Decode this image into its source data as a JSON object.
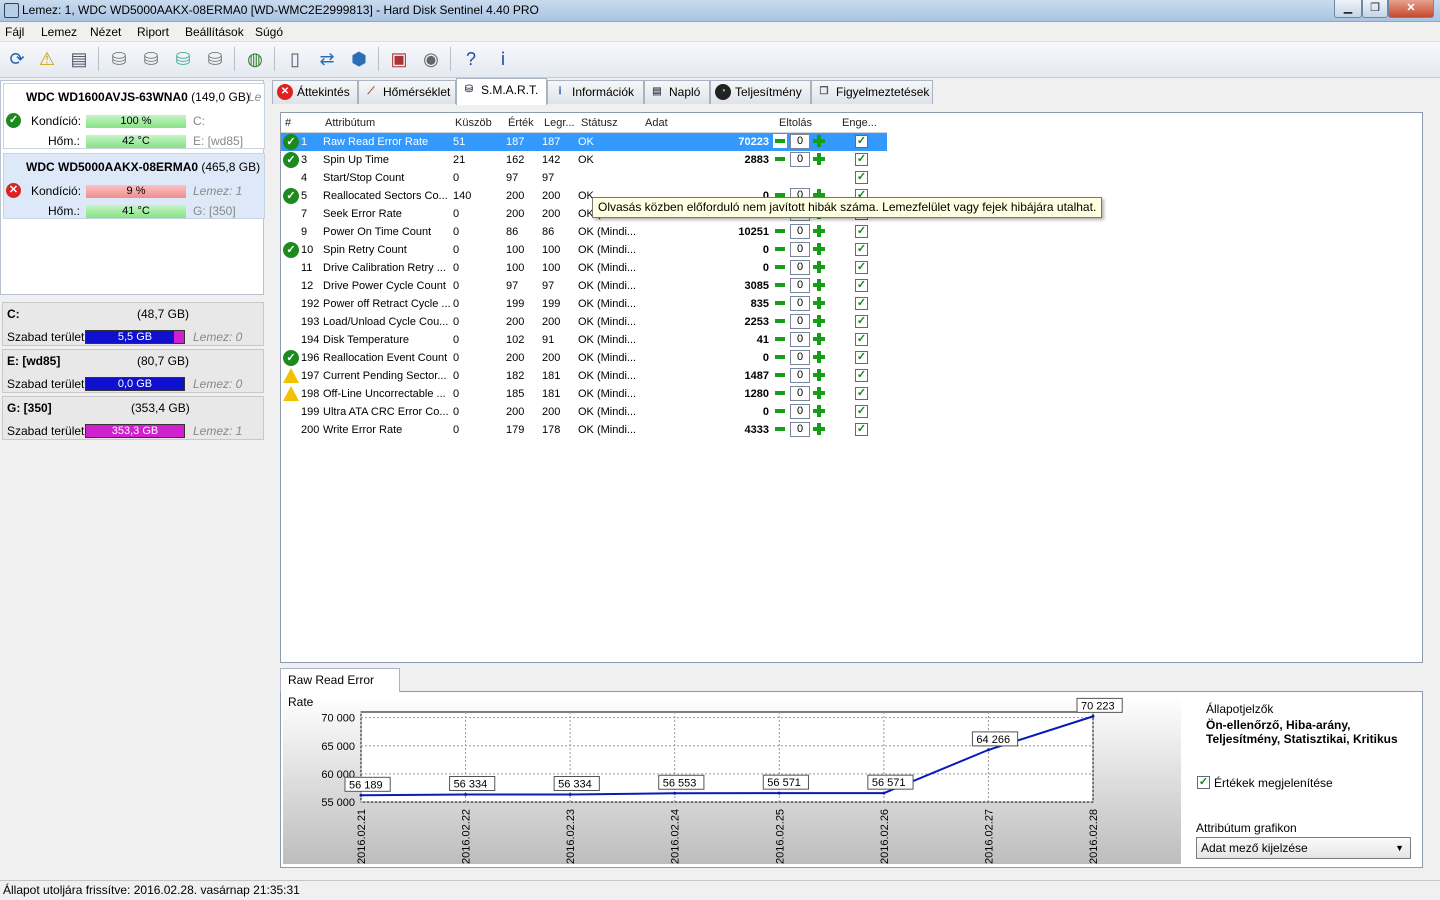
{
  "window": {
    "title": "Lemez: 1, WDC WD5000AAKX-08ERMA0 [WD-WMC2E2999813]  -  Hard Disk Sentinel 4.40 PRO"
  },
  "menu": [
    "Fájl",
    "Lemez",
    "Nézet",
    "Riport",
    "Beállítások",
    "Súgó"
  ],
  "disks": [
    {
      "name": "WDC WD1600AVJS-63WNA0",
      "size": "(149,0 GB)",
      "side_label": "Le",
      "condition_label": "Kondíció:",
      "condition": "100 %",
      "condition_fraction": 1.0,
      "temp_label": "Hőm.:",
      "temp": "42 °C",
      "drive1": "C:",
      "drive2": "E: [wd85]"
    },
    {
      "name": "WDC WD5000AAKX-08ERMA0",
      "size": "(465,8 GB)",
      "condition_label": "Kondíció:",
      "condition": "9 %",
      "condition_fraction": 0.09,
      "temp_label": "Hőm.:",
      "temp": "41 °C",
      "drive1": "Lemez: 1",
      "drive2": "G: [350]"
    }
  ],
  "volumes": [
    {
      "name": "C:",
      "size": "(48,7 GB)",
      "free_label": "Szabad terület",
      "free": "5,5 GB",
      "disk": "Lemez: 0"
    },
    {
      "name": "E: [wd85]",
      "size": "(80,7 GB)",
      "free_label": "Szabad terület",
      "free": "0,0 GB",
      "disk": "Lemez: 0"
    },
    {
      "name": "G: [350]",
      "size": "(353,4 GB)",
      "free_label": "Szabad terület",
      "free": "353,3 GB",
      "disk": "Lemez: 1"
    }
  ],
  "tabs": [
    "Áttekintés",
    "Hőmérséklet",
    "S.M.A.R.T.",
    "Információk",
    "Napló",
    "Teljesítmény",
    "Figyelmeztetések"
  ],
  "smart": {
    "headers": {
      "num": "#",
      "attr": "Attribútum",
      "threshold": "Küszöb",
      "value": "Érték",
      "worst": "Legr...",
      "status": "Státusz",
      "data": "Adat",
      "offset": "Eltolás",
      "enable": "Enge..."
    },
    "rows": [
      {
        "icon": "ok",
        "num": "1",
        "attr": "Raw Read Error Rate",
        "threshold": "51",
        "value": "187",
        "worst": "187",
        "status": "OK",
        "data": "70223",
        "offset": "0"
      },
      {
        "icon": "ok",
        "num": "3",
        "attr": "Spin Up Time",
        "threshold": "21",
        "value": "162",
        "worst": "142",
        "status": "OK",
        "data": "2883",
        "offset": "0"
      },
      {
        "icon": "",
        "num": "4",
        "attr": "Start/Stop Count",
        "threshold": "0",
        "value": "97",
        "worst": "97",
        "status": "",
        "data": "",
        "offset": ""
      },
      {
        "icon": "ok",
        "num": "5",
        "attr": "Reallocated Sectors Co...",
        "threshold": "140",
        "value": "200",
        "worst": "200",
        "status": "OK",
        "data": "0",
        "offset": "0"
      },
      {
        "icon": "",
        "num": "7",
        "attr": "Seek Error Rate",
        "threshold": "0",
        "value": "200",
        "worst": "200",
        "status": "OK (Mindi...",
        "data": "0",
        "offset": "0"
      },
      {
        "icon": "",
        "num": "9",
        "attr": "Power On Time Count",
        "threshold": "0",
        "value": "86",
        "worst": "86",
        "status": "OK (Mindi...",
        "data": "10251",
        "offset": "0"
      },
      {
        "icon": "ok",
        "num": "10",
        "attr": "Spin Retry Count",
        "threshold": "0",
        "value": "100",
        "worst": "100",
        "status": "OK (Mindi...",
        "data": "0",
        "offset": "0"
      },
      {
        "icon": "",
        "num": "11",
        "attr": "Drive Calibration Retry ...",
        "threshold": "0",
        "value": "100",
        "worst": "100",
        "status": "OK (Mindi...",
        "data": "0",
        "offset": "0"
      },
      {
        "icon": "",
        "num": "12",
        "attr": "Drive Power Cycle Count",
        "threshold": "0",
        "value": "97",
        "worst": "97",
        "status": "OK (Mindi...",
        "data": "3085",
        "offset": "0"
      },
      {
        "icon": "",
        "num": "192",
        "attr": "Power off Retract Cycle ...",
        "threshold": "0",
        "value": "199",
        "worst": "199",
        "status": "OK (Mindi...",
        "data": "835",
        "offset": "0"
      },
      {
        "icon": "",
        "num": "193",
        "attr": "Load/Unload Cycle Cou...",
        "threshold": "0",
        "value": "200",
        "worst": "200",
        "status": "OK (Mindi...",
        "data": "2253",
        "offset": "0"
      },
      {
        "icon": "",
        "num": "194",
        "attr": "Disk Temperature",
        "threshold": "0",
        "value": "102",
        "worst": "91",
        "status": "OK (Mindi...",
        "data": "41",
        "offset": "0"
      },
      {
        "icon": "ok",
        "num": "196",
        "attr": "Reallocation Event Count",
        "threshold": "0",
        "value": "200",
        "worst": "200",
        "status": "OK (Mindi...",
        "data": "0",
        "offset": "0"
      },
      {
        "icon": "warn",
        "num": "197",
        "attr": "Current Pending Sector...",
        "threshold": "0",
        "value": "182",
        "worst": "181",
        "status": "OK (Mindi...",
        "data": "1487",
        "offset": "0"
      },
      {
        "icon": "warn",
        "num": "198",
        "attr": "Off-Line Uncorrectable ...",
        "threshold": "0",
        "value": "185",
        "worst": "181",
        "status": "OK (Mindi...",
        "data": "1280",
        "offset": "0"
      },
      {
        "icon": "",
        "num": "199",
        "attr": "Ultra ATA CRC Error Co...",
        "threshold": "0",
        "value": "200",
        "worst": "200",
        "status": "OK (Mindi...",
        "data": "0",
        "offset": "0"
      },
      {
        "icon": "",
        "num": "200",
        "attr": "Write Error Rate",
        "threshold": "0",
        "value": "179",
        "worst": "178",
        "status": "OK (Mindi...",
        "data": "4333",
        "offset": "0"
      }
    ],
    "tooltip": "Olvasás közben előforduló nem javított hibák száma. Lemezfelület vagy fejek hibájára utalhat."
  },
  "chart_tab": "Raw Read Error Rate",
  "chart_data": {
    "type": "line",
    "categories": [
      "2016.02.21",
      "2016.02.22",
      "2016.02.23",
      "2016.02.24",
      "2016.02.25",
      "2016.02.26",
      "2016.02.27",
      "2016.02.28"
    ],
    "values": [
      56189,
      56334,
      56334,
      56553,
      56571,
      56571,
      64266,
      70223
    ],
    "data_labels": [
      "56 189",
      "56 334",
      "56 334",
      "56 553",
      "56 571",
      "56 571",
      "64 266",
      "70 223"
    ],
    "yticks": [
      "70 000",
      "65 000",
      "60 000",
      "55 000"
    ],
    "ytick_values": [
      70000,
      65000,
      60000,
      55000
    ],
    "ylim": [
      55000,
      71000
    ],
    "line_color": "#0a1ab8",
    "grid": true
  },
  "chart_side": {
    "indicators_label": "Állapotjelzők",
    "indicators_text": "Ön-ellenőrző, Hiba-arány, Teljesítmény, Statisztikai, Kritikus",
    "show_values_label": "Értékek megjelenítése",
    "graph_label": "Attribútum grafikon",
    "graph_option": "Adat mező kijelzése"
  },
  "status": "Állapot utoljára frissítve: 2016.02.28. vasárnap 21:35:31"
}
